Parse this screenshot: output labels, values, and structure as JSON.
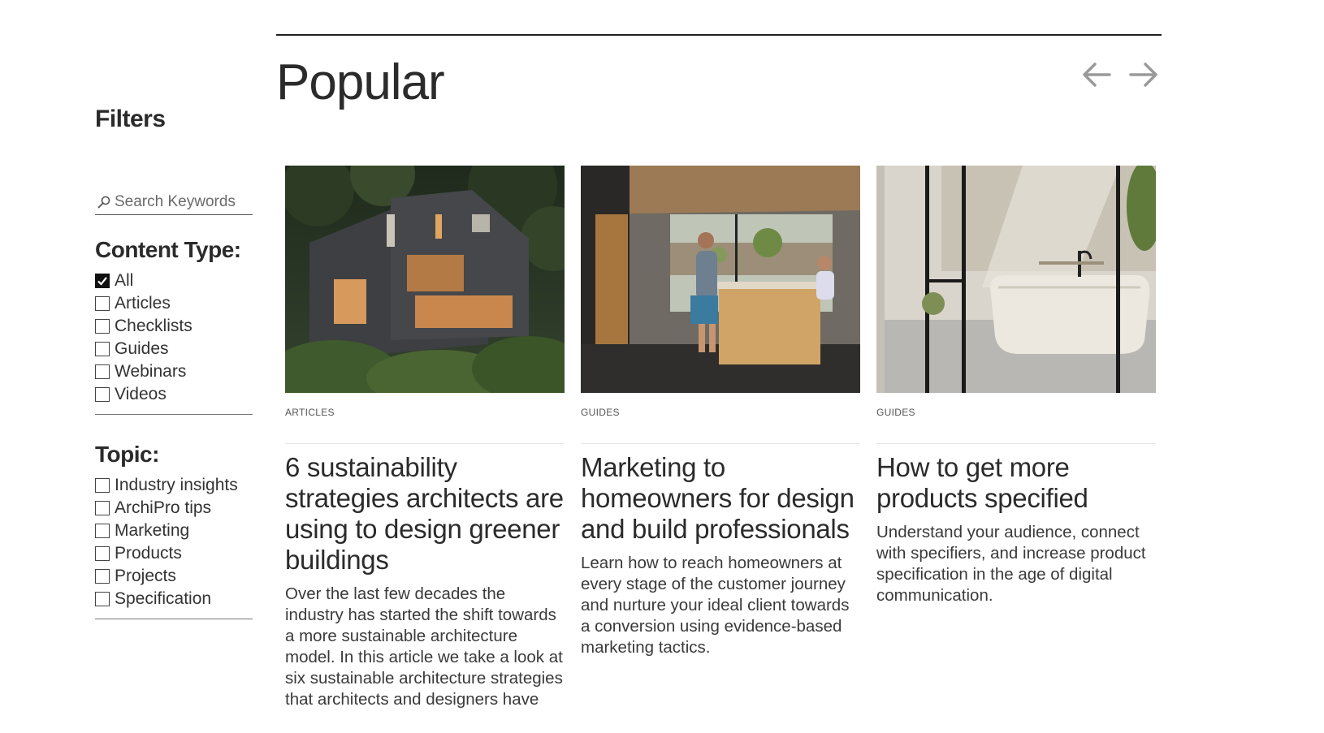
{
  "header": {
    "title": "Popular",
    "prev_icon": "arrow-left-icon",
    "next_icon": "arrow-right-icon"
  },
  "sidebar": {
    "title": "Filters",
    "search": {
      "placeholder": "Search Keywords",
      "value": "",
      "icon": "search-icon"
    },
    "content_type": {
      "title": "Content Type:",
      "options": [
        {
          "label": "All",
          "checked": true
        },
        {
          "label": "Articles",
          "checked": false
        },
        {
          "label": "Checklists",
          "checked": false
        },
        {
          "label": "Guides",
          "checked": false
        },
        {
          "label": "Webinars",
          "checked": false
        },
        {
          "label": "Videos",
          "checked": false
        }
      ]
    },
    "topic": {
      "title": "Topic:",
      "options": [
        {
          "label": "Industry insights",
          "checked": false
        },
        {
          "label": "ArchiPro tips",
          "checked": false
        },
        {
          "label": "Marketing",
          "checked": false
        },
        {
          "label": "Products",
          "checked": false
        },
        {
          "label": "Projects",
          "checked": false
        },
        {
          "label": "Specification",
          "checked": false
        }
      ]
    }
  },
  "cards": [
    {
      "type": "ARTICLES",
      "title": "6 sustainability strategies architects are using to design greener buildings",
      "description": "Over the last few decades the industry has started the shift towards a more sustainable architecture model. In this article we take a look at six sustainable architecture strategies that architects and designers have",
      "image": "dark-timber-house-photo"
    },
    {
      "type": "GUIDES",
      "title": "Marketing to homeowners for design and build professionals",
      "description": "Learn how to reach homeowners at every stage of the customer journey and nurture your ideal client towards a conversion using evidence-based marketing tactics.",
      "image": "kitchen-island-photo"
    },
    {
      "type": "GUIDES",
      "title": "How to get more products specified",
      "description": "Understand your audience, connect with specifiers, and increase product specification in the age of digital communication.",
      "image": "bathroom-bathtub-photo"
    }
  ],
  "colors": {
    "text": "#2b2b2b",
    "rule": "#1f1f1f",
    "arrow": "#9a9a9a"
  }
}
